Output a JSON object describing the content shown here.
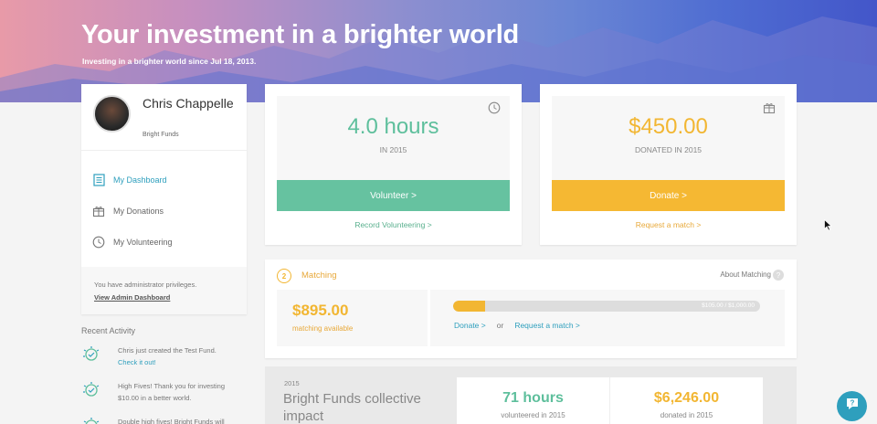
{
  "hero": {
    "title": "Your investment in a brighter world",
    "subtitle": "Investing in a brighter world since Jul 18, 2013."
  },
  "profile": {
    "name": "Chris Chappelle",
    "org": "Bright Funds",
    "nav": [
      {
        "label": "My Dashboard",
        "icon": "dashboard-icon",
        "active": true
      },
      {
        "label": "My Donations",
        "icon": "gift-icon",
        "active": false
      },
      {
        "label": "My Volunteering",
        "icon": "clock-icon",
        "active": false
      }
    ],
    "admin_text": "You have administrator privileges.",
    "admin_link": "View Admin Dashboard"
  },
  "recent_activity": {
    "title": "Recent Activity",
    "items": [
      {
        "text": "Chris just created the Test Fund.",
        "link": "Check it out!"
      },
      {
        "text": "High Fives! Thank you for investing $10.00 in a better world.",
        "link": ""
      },
      {
        "text": "Double high fives! Bright Funds will",
        "link": ""
      }
    ]
  },
  "volunteer": {
    "value": "4.0 hours",
    "label": "IN 2015",
    "button": "Volunteer >",
    "link": "Record Volunteering >"
  },
  "donations": {
    "value": "$450.00",
    "label": "DONATED IN 2015",
    "button": "Donate >",
    "link": "Request a match >"
  },
  "matching": {
    "badge": "2",
    "title": "Matching",
    "about": "About Matching",
    "help": "?",
    "amount": "$895.00",
    "amount_label": "matching available",
    "progress_fraction": 0.105,
    "progress_text": "$105.00 / $1,000.00",
    "donate_link": "Donate >",
    "or": "or",
    "request_link": "Request a match >"
  },
  "collective": {
    "year": "2015",
    "title": "Bright Funds collective impact",
    "stats": [
      {
        "value": "71 hours",
        "label": "volunteered in 2015"
      },
      {
        "value": "$6,246.00",
        "label": "donated in 2015"
      }
    ]
  },
  "colors": {
    "accent_teal": "#2e9fbd",
    "green": "#66c2a0",
    "gold": "#f5b833"
  }
}
